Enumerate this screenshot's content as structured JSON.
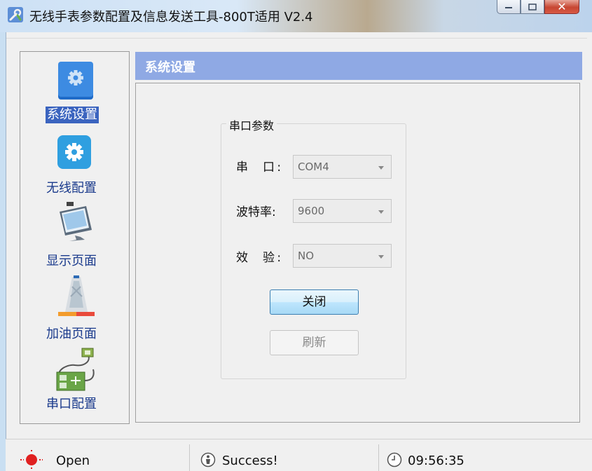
{
  "window": {
    "title": "无线手表参数配置及信息发送工具-800T适用 V2.4",
    "buttons": [
      "minimize",
      "maximize",
      "close"
    ]
  },
  "sidebar": {
    "items": [
      {
        "label": "系统设置",
        "icon": "settings-box-icon",
        "selected": true
      },
      {
        "label": "无线配置",
        "icon": "gear-icon",
        "selected": false
      },
      {
        "label": "显示页面",
        "icon": "monitor-icon",
        "selected": false
      },
      {
        "label": "加油页面",
        "icon": "tower-icon",
        "selected": false
      },
      {
        "label": "串口配置",
        "icon": "serial-cable-icon",
        "selected": false
      }
    ]
  },
  "panel": {
    "header": "系统设置",
    "group": {
      "title": "串口参数",
      "fields": [
        {
          "label": "串  口:",
          "value": "COM4"
        },
        {
          "label": "波特率:",
          "value": "9600"
        },
        {
          "label": "效  验:",
          "value": "NO"
        }
      ],
      "primary_button": "关闭",
      "refresh_button": "刷新"
    }
  },
  "statusbar": {
    "port_state": "Open",
    "message": "Success!",
    "time": "09:56:35"
  },
  "colors": {
    "accent": "#8fa9e4",
    "selected": "#3b64bf",
    "nav_text": "#1a3a8c",
    "status_red": "#e02020"
  }
}
